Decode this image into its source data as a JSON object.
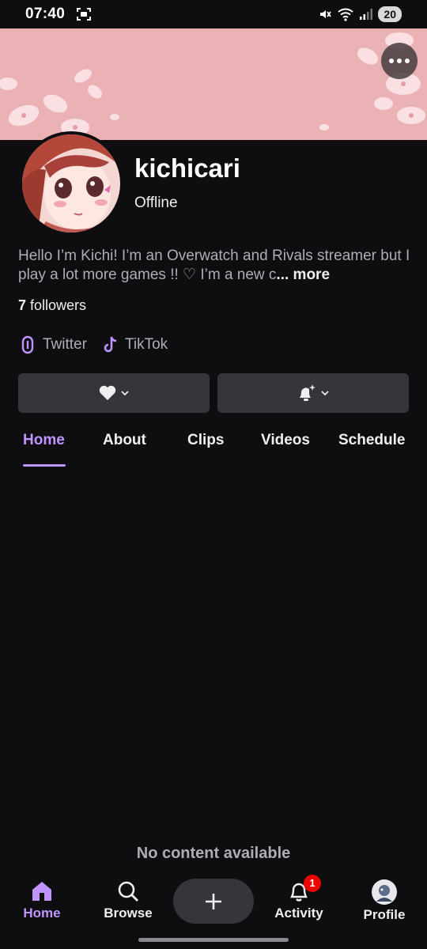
{
  "status_bar": {
    "time": "07:40",
    "battery": "20"
  },
  "channel": {
    "name": "kichicari",
    "status": "Offline",
    "bio": "Hello I’m Kichi! I’m an Overwatch and Rivals streamer but I play a lot more games !! ♡ I’m a new c",
    "bio_more": "... more",
    "followers_count": "7",
    "followers_label": "followers"
  },
  "socials": [
    {
      "label": "Twitter",
      "icon": "link-icon"
    },
    {
      "label": "TikTok",
      "icon": "tiktok-icon"
    }
  ],
  "tabs": [
    {
      "label": "Home"
    },
    {
      "label": "About"
    },
    {
      "label": "Clips"
    },
    {
      "label": "Videos"
    },
    {
      "label": "Schedule"
    }
  ],
  "content": {
    "empty_message": "No content available"
  },
  "bottom_nav": {
    "home": "Home",
    "browse": "Browse",
    "activity": "Activity",
    "activity_badge": "1",
    "profile": "Profile"
  },
  "colors": {
    "accent": "#bf94ff",
    "background": "#0e0e10",
    "banner": "#ebb2b6",
    "badge": "#eb0400"
  }
}
